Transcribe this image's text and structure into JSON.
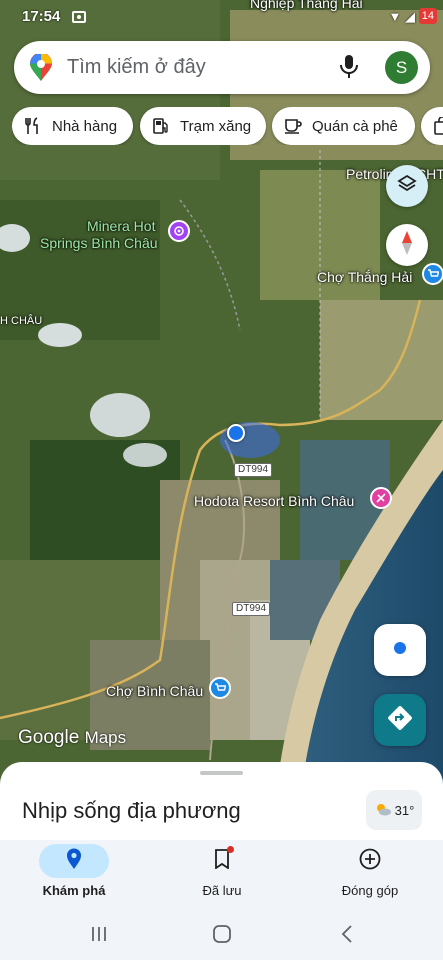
{
  "status_bar": {
    "time": "17:54",
    "right_icons": "▼ ◢",
    "battery": "14"
  },
  "search": {
    "placeholder": "Tìm kiếm ở đây",
    "avatar_letter": "S"
  },
  "chips": [
    {
      "label": "Nhà hàng",
      "icon": "restaurant-icon"
    },
    {
      "label": "Trạm xăng",
      "icon": "gas-station-icon"
    },
    {
      "label": "Quán cà phê",
      "icon": "coffee-icon"
    },
    {
      "label": "",
      "icon": "shopping-bag-icon"
    }
  ],
  "map": {
    "labels": {
      "top_partial": "Nghiệp Thắng Hải",
      "petrolimex": "Petrolimex CHT",
      "minera_line1": "Minera Hot",
      "minera_line2": "Springs Bình Châu",
      "cho_thang_hai": "Chợ Thắng Hải",
      "binh_chau_partial": "H CHÂU",
      "hodota": "Hodota Resort Bình Châu",
      "cho_binh_chau": "Chợ Bình Châu"
    },
    "road_shields": [
      "DT994",
      "DT994"
    ],
    "logo_google": "Google",
    "logo_maps": "Maps"
  },
  "sheet": {
    "title": "Nhịp sống địa phương",
    "temperature": "31°"
  },
  "bottom_nav": [
    {
      "label": "Khám phá",
      "icon": "explore-pin-icon",
      "active": true
    },
    {
      "label": "Đã lưu",
      "icon": "bookmark-icon",
      "active": false
    },
    {
      "label": "Đóng góp",
      "icon": "add-circle-icon",
      "active": false
    }
  ],
  "colors": {
    "accent_blue": "#1a73e8",
    "active_pill": "#c2e7ff",
    "directions_teal": "#0f7a8a",
    "poi_purple": "#a142f4",
    "poi_pink": "#e040a0",
    "poi_blue": "#1e88e5"
  }
}
